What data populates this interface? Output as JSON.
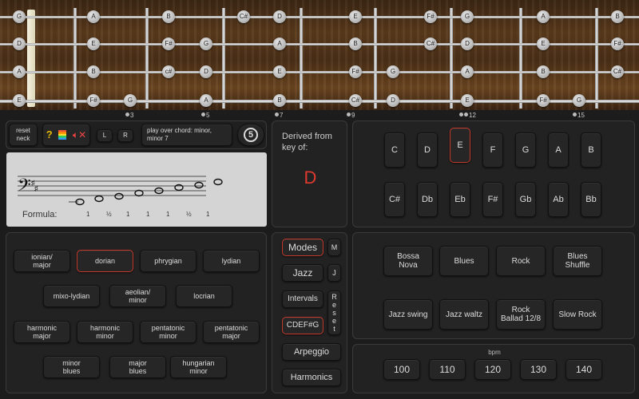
{
  "fretboard": {
    "strings": [
      {
        "notes": [
          "G",
          "A",
          "B",
          "C#",
          "D",
          "E",
          "F#",
          "G",
          "A",
          "B"
        ]
      },
      {
        "notes": [
          "D",
          "E",
          "F#",
          "G",
          "A",
          "B",
          "C#",
          "D",
          "E",
          "F#"
        ]
      },
      {
        "notes": [
          "A",
          "B",
          "c#",
          "D",
          "E",
          "F#",
          "G",
          "A",
          "B",
          "C#"
        ]
      },
      {
        "notes": [
          "E",
          "F#",
          "G",
          "A",
          "B",
          "C#",
          "D",
          "E",
          "F#",
          "G"
        ]
      }
    ],
    "fret_numbers": [
      "3",
      "5",
      "7",
      "9",
      "12",
      "15"
    ]
  },
  "controls": {
    "reset_neck": "reset\nneck",
    "help": "?",
    "left": "L",
    "right": "R",
    "chord_info": "play over chord: minor,\nminor 7",
    "string_count": "5"
  },
  "staff": {
    "formula_label": "Formula:",
    "intervals": [
      "1",
      "½",
      "1",
      "1",
      "1",
      "½",
      "1"
    ]
  },
  "derived": {
    "label": "Derived from\nkey of:",
    "key": "D"
  },
  "keys": [
    "C",
    "D",
    "E",
    "F",
    "G",
    "A",
    "B",
    "C#",
    "Db",
    "Eb",
    "F#",
    "Gb",
    "Ab",
    "Bb"
  ],
  "selected_key": "E",
  "scales": [
    "ionian/\nmajor",
    "dorian",
    "phrygian",
    "lydian",
    "mixo-lydian",
    "aeolian/\nminor",
    "locrian",
    "harmonic\nmajor",
    "harmonic\nminor",
    "pentatonic\nminor",
    "pentatonic\nmajor",
    "minor\nblues",
    "major\nblues",
    "hungarian\nminor"
  ],
  "selected_scale": "dorian",
  "modes": {
    "modes": "Modes",
    "m": "M",
    "jazz": "Jazz",
    "j": "J",
    "intervals": "Intervals",
    "reset": "R\ne\ns\ne\nt",
    "cdef": "CDEF#G",
    "arpeggio": "Arpeggio",
    "harmonics": "Harmonics"
  },
  "rhythms": [
    "Bossa\nNova",
    "Blues",
    "Rock",
    "Blues\nShuffle",
    "Jazz swing",
    "Jazz waltz",
    "Rock\nBallad 12/8",
    "Slow Rock"
  ],
  "bpm": {
    "label": "bpm",
    "values": [
      "100",
      "110",
      "120",
      "130",
      "140"
    ]
  },
  "colors": {
    "accent": "#e03a2f",
    "neck": "#4a2f16"
  }
}
